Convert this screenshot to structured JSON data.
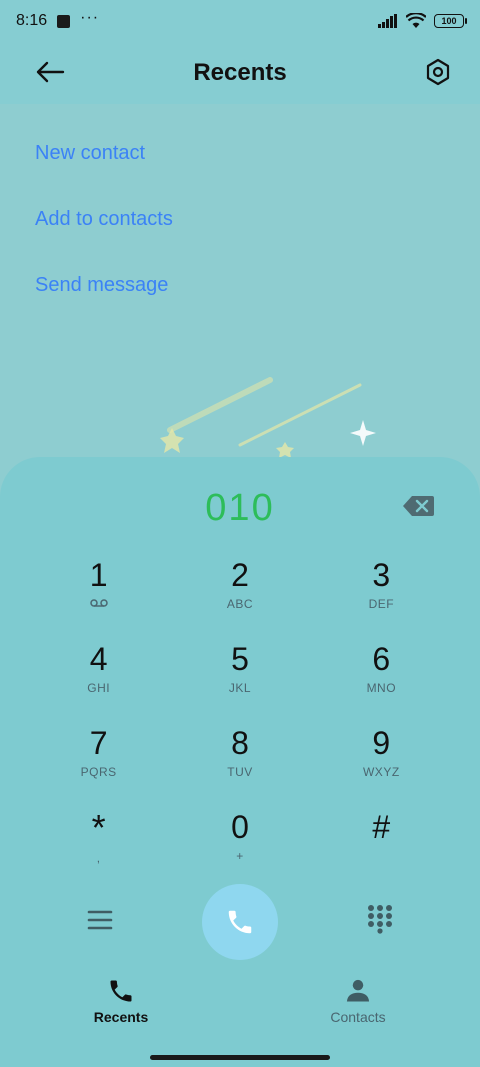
{
  "status": {
    "time": "8:16",
    "dots": "···",
    "battery": "100"
  },
  "header": {
    "title": "Recents",
    "back_icon": "arrow-left-icon",
    "settings_icon": "hexagon-settings-icon"
  },
  "options": [
    {
      "label": "New contact"
    },
    {
      "label": "Add to contacts"
    },
    {
      "label": "Send message"
    }
  ],
  "dialer": {
    "number": "010",
    "keys": [
      {
        "digit": "1",
        "letters": ""
      },
      {
        "digit": "2",
        "letters": "ABC"
      },
      {
        "digit": "3",
        "letters": "DEF"
      },
      {
        "digit": "4",
        "letters": "GHI"
      },
      {
        "digit": "5",
        "letters": "JKL"
      },
      {
        "digit": "6",
        "letters": "MNO"
      },
      {
        "digit": "7",
        "letters": "PQRS"
      },
      {
        "digit": "8",
        "letters": "TUV"
      },
      {
        "digit": "9",
        "letters": "WXYZ"
      },
      {
        "digit": "*",
        "letters": ","
      },
      {
        "digit": "0",
        "letters": "+"
      },
      {
        "digit": "#",
        "letters": ""
      }
    ]
  },
  "tabs": {
    "recents": "Recents",
    "contacts": "Contacts"
  },
  "colors": {
    "accent_link": "#3b82f6",
    "number_green": "#2dbd5a",
    "call_button": "#8fd7ef"
  }
}
